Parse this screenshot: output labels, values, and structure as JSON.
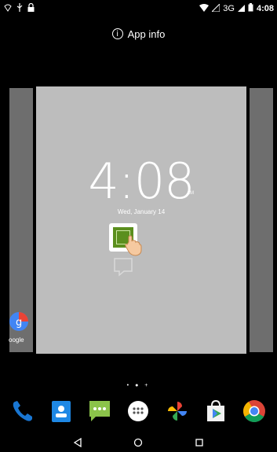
{
  "status_bar": {
    "time": "4:08",
    "network": "3G"
  },
  "recents": {
    "app_info_label": "App info",
    "clock_time": "4:08",
    "clock_ampm": "AM",
    "date": "Wed, January 14",
    "left_card_label": "oogle"
  },
  "home": {
    "page_indicator": "• ● +",
    "dock": [
      {
        "name": "phone",
        "icon": "phone-icon",
        "color": "#1976d2"
      },
      {
        "name": "contacts",
        "icon": "contacts-icon",
        "color": "#1e88e5"
      },
      {
        "name": "messaging",
        "icon": "messaging-icon",
        "color": "#8bc34a"
      },
      {
        "name": "app-drawer",
        "icon": "app-drawer-icon",
        "color": "#ffffff"
      },
      {
        "name": "photos",
        "icon": "photos-icon",
        "color": "#fbbc05"
      },
      {
        "name": "play-store",
        "icon": "play-store-icon",
        "color": "#34a853"
      },
      {
        "name": "chrome",
        "icon": "chrome-icon",
        "color": "#db4437"
      }
    ]
  },
  "navigation": [
    "back",
    "home",
    "recents"
  ]
}
